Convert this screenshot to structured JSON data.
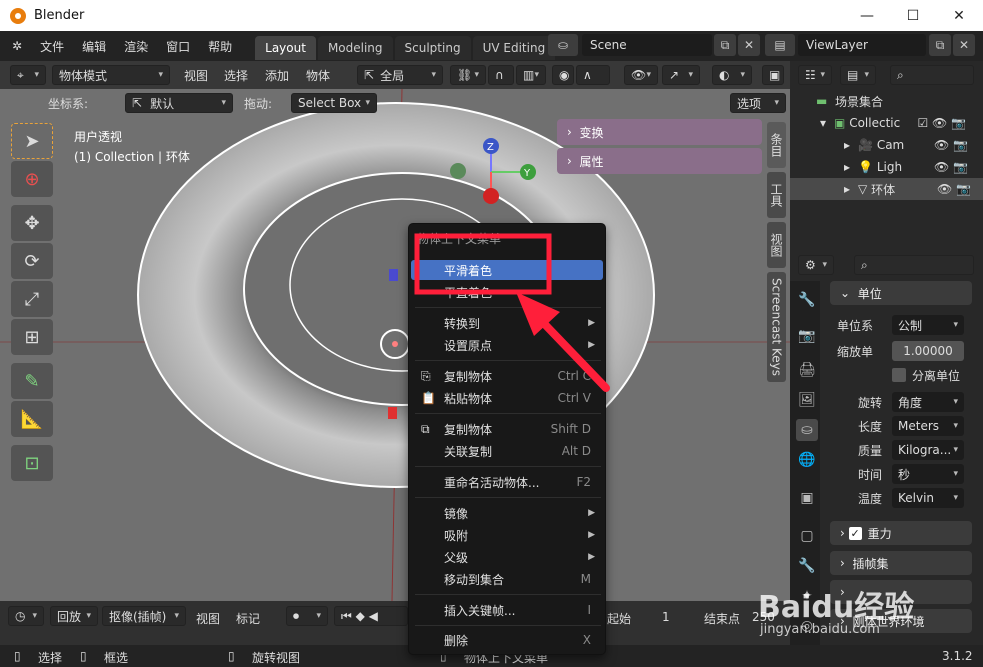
{
  "window": {
    "title": "Blender",
    "min": "—",
    "max": "☐",
    "close": "✕"
  },
  "menubar": {
    "items": [
      "文件",
      "编辑",
      "渲染",
      "窗口",
      "帮助"
    ],
    "tabs": [
      "Layout",
      "Modeling",
      "Sculpting",
      "UV Editing"
    ],
    "scene": "Scene",
    "viewlayer": "ViewLayer"
  },
  "header": {
    "mode": "物体模式",
    "menus": [
      "视图",
      "选择",
      "添加",
      "物体"
    ],
    "transform": "全局"
  },
  "toolheader": {
    "coord_label": "坐标系:",
    "coord_value": "默认",
    "drag_label": "拖动:",
    "drag_value": "Select Box",
    "options": "选项"
  },
  "viewport": {
    "perspective": "用户透视",
    "collection_info": "(1) Collection | 环体",
    "gizmo": {
      "z": "Z",
      "y": "Y"
    }
  },
  "npanel": {
    "transform": "变换",
    "properties": "属性"
  },
  "vtabs": [
    "条目",
    "工具",
    "视图",
    "Screencast Keys"
  ],
  "context_menu": {
    "title": "物体上下文菜单",
    "items": [
      {
        "label": "平滑着色",
        "shortcut": ""
      },
      {
        "label": "平直着色",
        "shortcut": ""
      },
      {
        "label": "转换到",
        "shortcut": "▶"
      },
      {
        "label": "设置原点",
        "shortcut": "▶"
      },
      {
        "label": "复制物体",
        "shortcut": "Ctrl C"
      },
      {
        "label": "粘贴物体",
        "shortcut": "Ctrl V"
      },
      {
        "label": "复制物体",
        "shortcut": "Shift D"
      },
      {
        "label": "关联复制",
        "shortcut": "Alt D"
      },
      {
        "label": "重命名活动物体...",
        "shortcut": "F2"
      },
      {
        "label": "镜像",
        "shortcut": "▶"
      },
      {
        "label": "吸附",
        "shortcut": "▶"
      },
      {
        "label": "父级",
        "shortcut": "▶"
      },
      {
        "label": "移动到集合",
        "shortcut": "M"
      },
      {
        "label": "插入关键帧...",
        "shortcut": "I"
      },
      {
        "label": "删除",
        "shortcut": "X"
      }
    ]
  },
  "timeline": {
    "playback": "回放",
    "keying": "抠像(插帧)",
    "view": "视图",
    "marker": "标记",
    "start_label": "起始",
    "start": "1",
    "end_label": "结束点",
    "end": "250"
  },
  "outliner": {
    "scene_collection": "场景集合",
    "items": [
      "Collectic",
      "Cam",
      "Ligh",
      "环体"
    ]
  },
  "props": {
    "units_title": "单位",
    "unit_system_label": "单位系",
    "unit_system": "公制",
    "scale_label": "缩放单",
    "scale": "1.00000",
    "separate_units": "分离单位",
    "rotation_label": "旋转",
    "rotation": "角度",
    "length_label": "长度",
    "length": "Meters",
    "mass_label": "质量",
    "mass": "Kilogra...",
    "time_label": "时间",
    "time": "秒",
    "temp_label": "温度",
    "temp": "Kelvin",
    "gravity": "重力",
    "keying_sets": "插帧集",
    "rigid_world": "刚体世界环境"
  },
  "statusbar": {
    "select": "选择",
    "box_select": "框选",
    "rotate_view": "旋转视图",
    "context": "物体上下文菜单",
    "version": "3.1.2"
  },
  "watermark": {
    "brand": "Baidu经验",
    "url": "jingyan.baidu.com"
  },
  "colors": {
    "highlight": "#4672c4",
    "annotation": "#ff1f3a",
    "npanel": "#8a6e8a"
  }
}
